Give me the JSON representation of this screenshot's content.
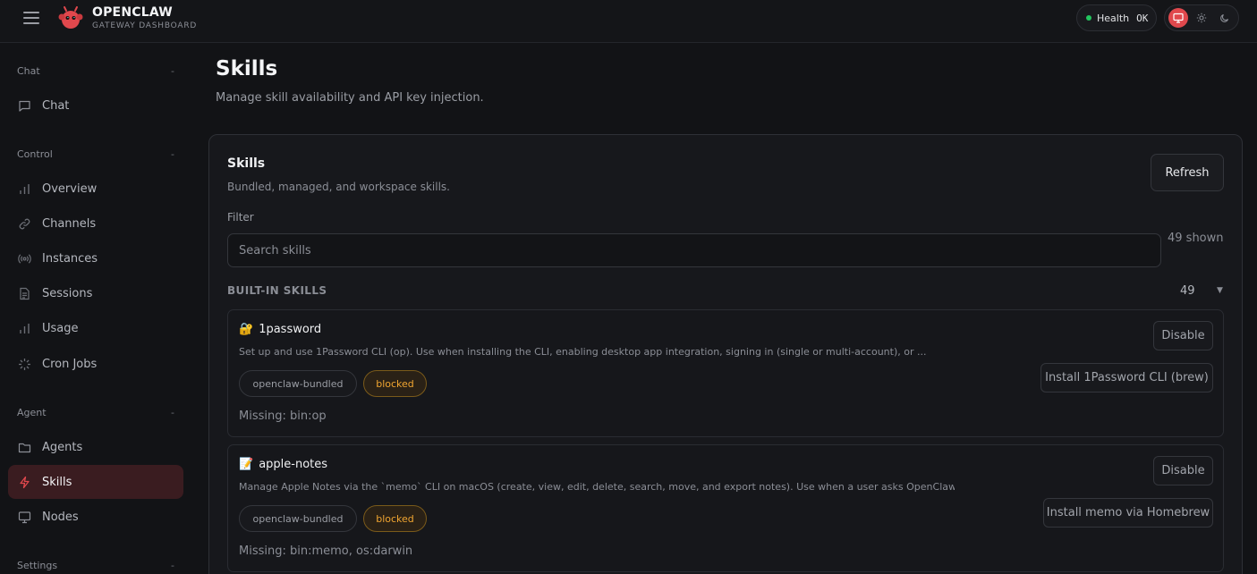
{
  "header": {
    "brand_title": "OPENCLAW",
    "brand_subtitle": "GATEWAY DASHBOARD",
    "health_label": "Health",
    "health_value": "OK",
    "status_color": "#22c55e",
    "accent_color": "#e0484d",
    "theme_options": [
      "system",
      "light",
      "dark"
    ],
    "theme_selected": "system"
  },
  "sidebar": {
    "sections": [
      {
        "title": "Chat",
        "collapse": "-",
        "items": [
          {
            "label": "Chat",
            "icon": "chat-bubble-icon"
          }
        ]
      },
      {
        "title": "Control",
        "collapse": "-",
        "items": [
          {
            "label": "Overview",
            "icon": "bar-chart-icon"
          },
          {
            "label": "Channels",
            "icon": "link-icon"
          },
          {
            "label": "Instances",
            "icon": "radio-icon"
          },
          {
            "label": "Sessions",
            "icon": "document-icon"
          },
          {
            "label": "Usage",
            "icon": "bar-chart-icon"
          },
          {
            "label": "Cron Jobs",
            "icon": "loader-icon"
          }
        ]
      },
      {
        "title": "Agent",
        "collapse": "-",
        "items": [
          {
            "label": "Agents",
            "icon": "folder-icon"
          },
          {
            "label": "Skills",
            "icon": "lightning-icon"
          },
          {
            "label": "Nodes",
            "icon": "monitor-icon"
          }
        ]
      },
      {
        "title": "Settings",
        "collapse": "-",
        "items": []
      }
    ],
    "active_item": "Skills"
  },
  "main": {
    "title": "Skills",
    "subtitle": "Manage skill availability and API key injection.",
    "card": {
      "title": "Skills",
      "subtitle": "Bundled, managed, and workspace skills.",
      "refresh_label": "Refresh",
      "filter_label": "Filter",
      "search_placeholder": "Search skills",
      "shown_text": "49 shown",
      "group_title": "BUILT-IN SKILLS",
      "group_count": "49",
      "skills": [
        {
          "emoji": "🔐",
          "name": "1password",
          "description": "Set up and use 1Password CLI (op). Use when installing the CLI, enabling desktop app integration, signing in (single or multi-account), or ...",
          "source": "openclaw-bundled",
          "status": "blocked",
          "missing": "Missing: bin:op",
          "disable_label": "Disable",
          "install_label": "Install 1Password CLI (brew)"
        },
        {
          "emoji": "📝",
          "name": "apple-notes",
          "description": "Manage Apple Notes via the `memo` CLI on macOS (create, view, edit, delete, search, move, and export notes). Use when a user asks OpenClaw ...",
          "source": "openclaw-bundled",
          "status": "blocked",
          "missing": "Missing: bin:memo, os:darwin",
          "disable_label": "Disable",
          "install_label": "Install memo via Homebrew"
        }
      ]
    }
  }
}
